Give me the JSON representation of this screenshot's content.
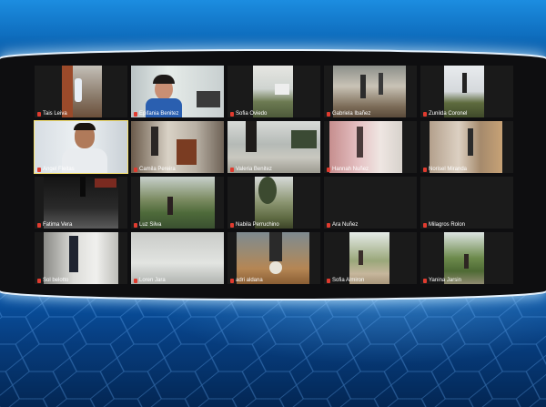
{
  "participants": [
    {
      "name": "Tais Leiva",
      "video": "gym",
      "wide": false
    },
    {
      "name": "Epifania Benitez",
      "video": "woman",
      "wide": true
    },
    {
      "name": "Sofia Oviedo",
      "video": "street",
      "wide": false
    },
    {
      "name": "Gabriela Ibañez",
      "video": "porch",
      "wide": false
    },
    {
      "name": "Zunilda Coronel",
      "video": "sky",
      "wide": false
    },
    {
      "name": "Angel Fleitas",
      "video": "man",
      "wide": true,
      "active": true
    },
    {
      "name": "Camila Pereira",
      "video": "room",
      "wide": true
    },
    {
      "name": "Valeria Benitez",
      "video": "yard",
      "wide": true
    },
    {
      "name": "Hannah Nuñez",
      "video": "pink",
      "wide": false
    },
    {
      "name": "Norisel Miranda",
      "video": "porch2",
      "wide": false
    },
    {
      "name": "Fatima Vera",
      "video": "dark",
      "wide": false
    },
    {
      "name": "Luz Silva",
      "video": "garden",
      "wide": false
    },
    {
      "name": "Nabila Perruchino",
      "video": "tree",
      "wide": false
    },
    {
      "name": "Ara Nuñez",
      "video": "black",
      "wide": false
    },
    {
      "name": "Milagros Rolon",
      "video": "black",
      "wide": false
    },
    {
      "name": "Sol belotto",
      "video": "hall",
      "wide": false
    },
    {
      "name": "Loren Jara",
      "video": "wall",
      "wide": true
    },
    {
      "name": "adri aldana",
      "video": "ball",
      "wide": false
    },
    {
      "name": "Sofia Almiron",
      "video": "field",
      "wide": false
    },
    {
      "name": "Yanina Jarsin",
      "video": "trees",
      "wide": false
    }
  ]
}
